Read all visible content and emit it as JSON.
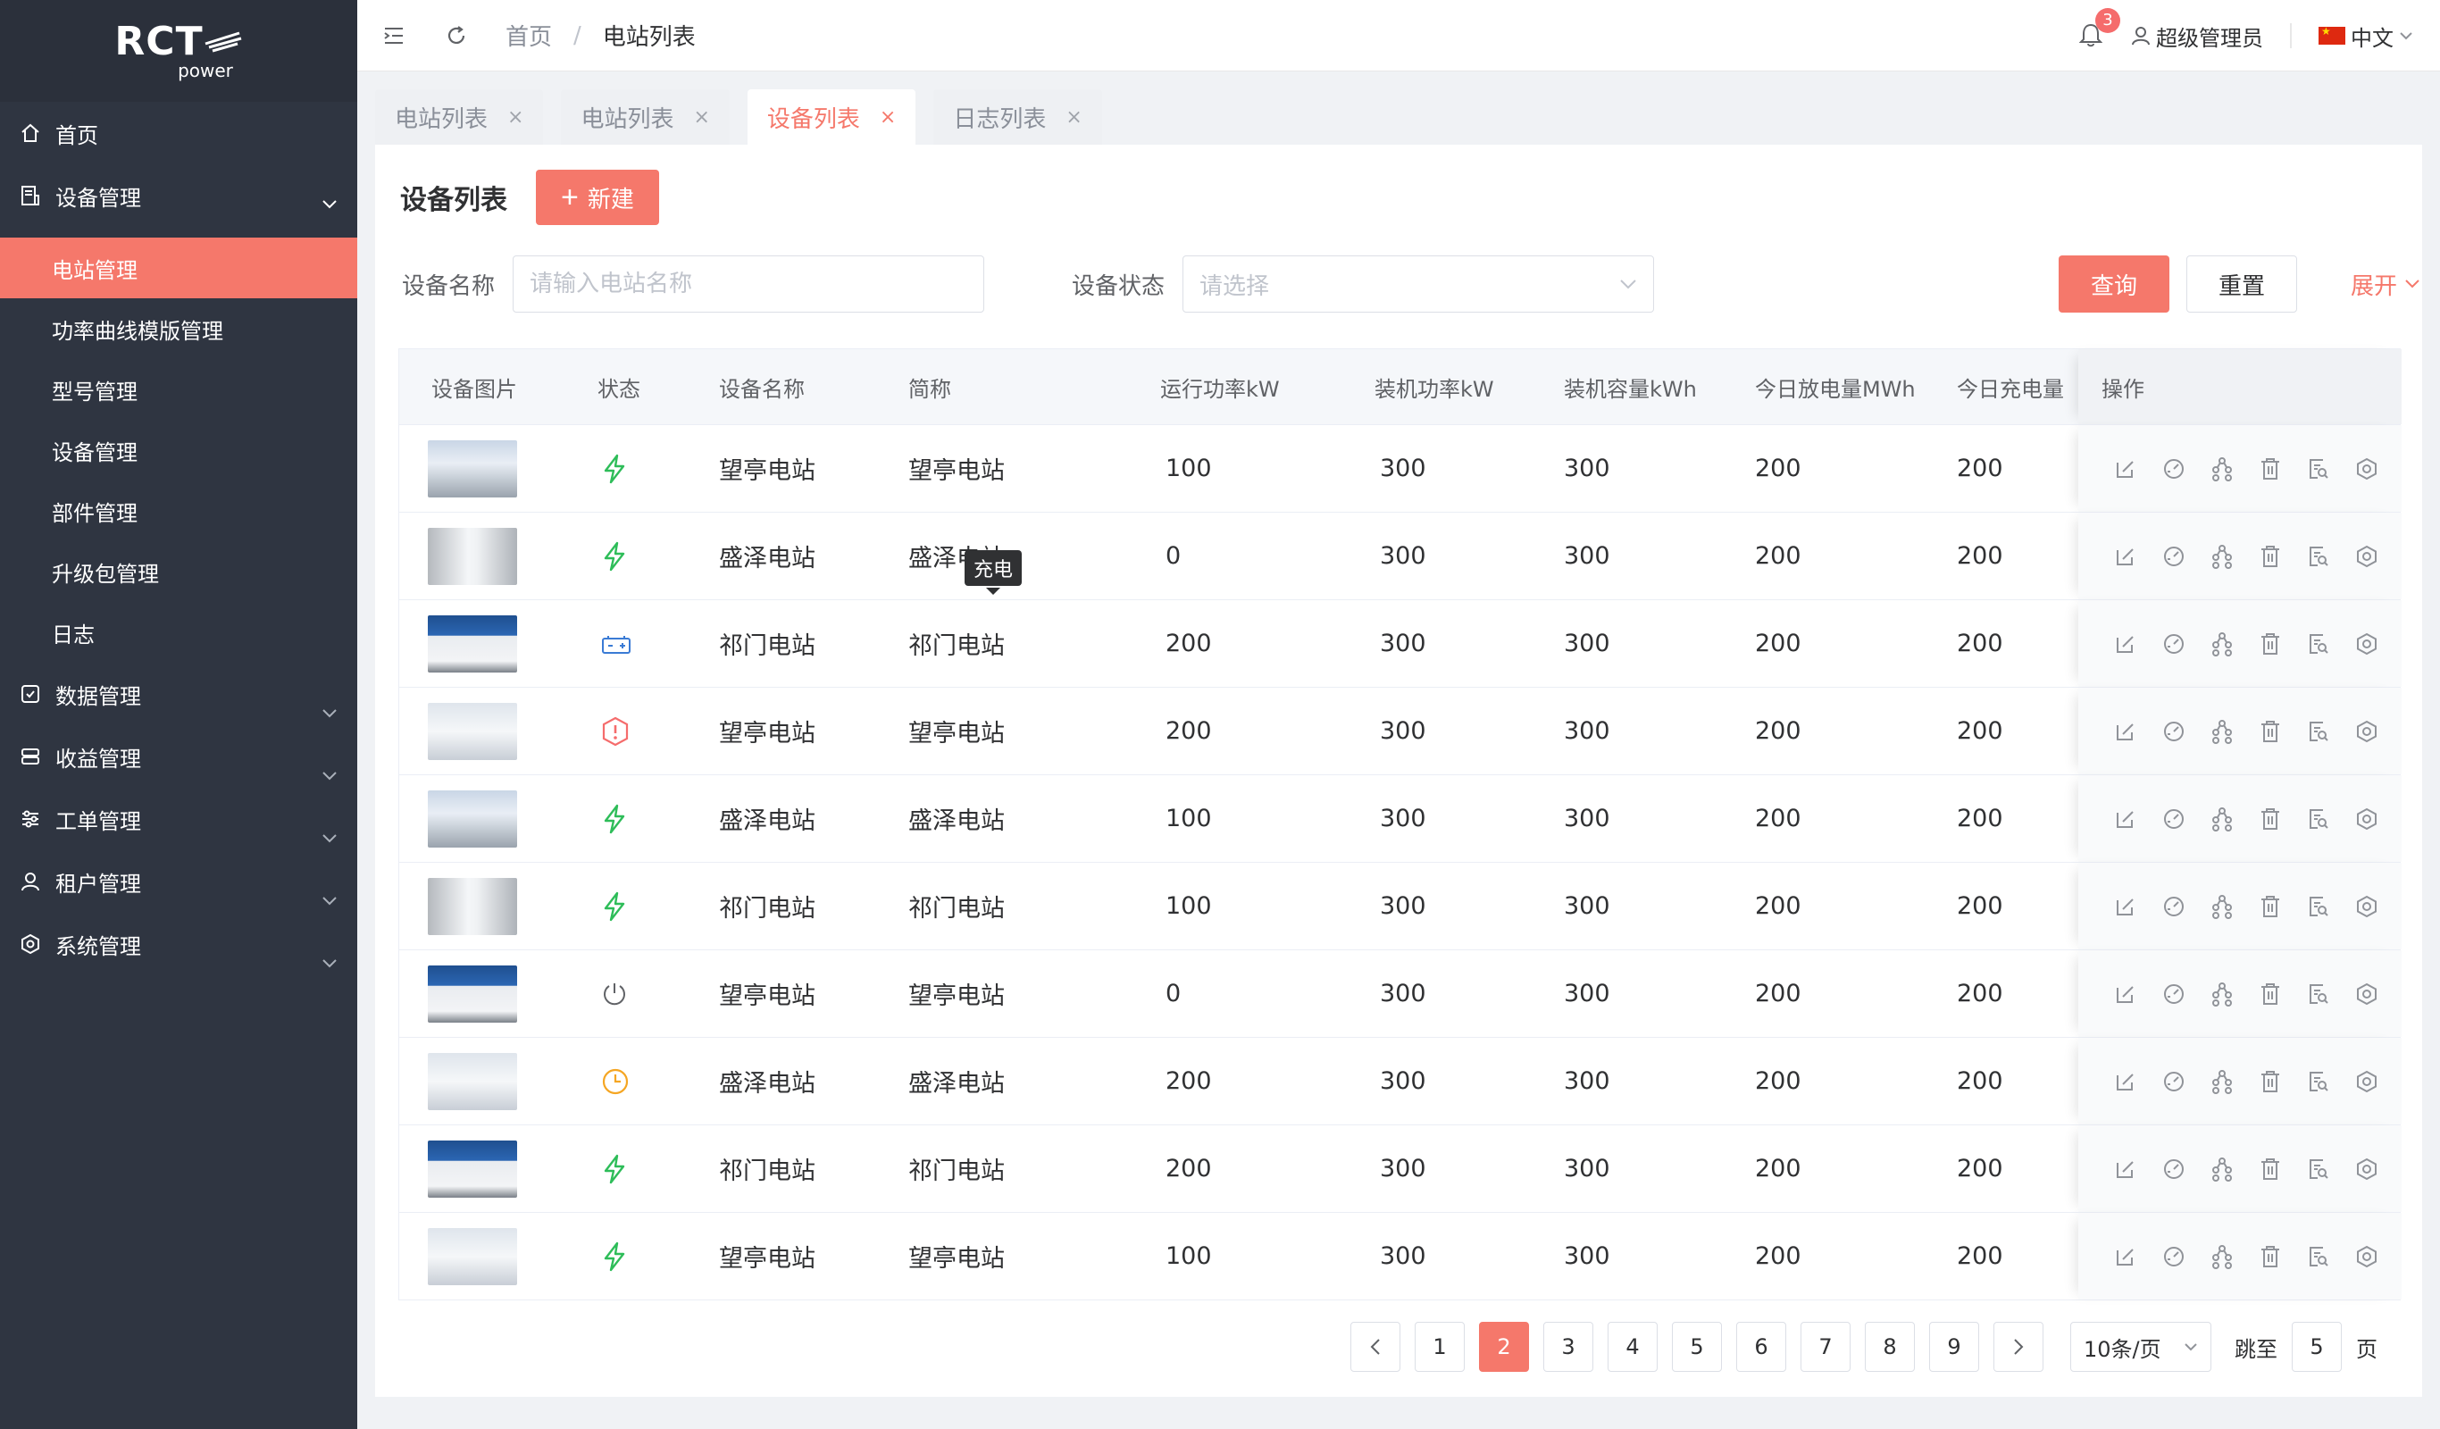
{
  "brand": {
    "name": "RCT",
    "sub": "power"
  },
  "sidebar": {
    "home": "首页",
    "device_mgmt": "设备管理",
    "subitems": [
      "电站管理",
      "功率曲线模版管理",
      "型号管理",
      "设备管理",
      "部件管理",
      "升级包管理",
      "日志"
    ],
    "groups": [
      "数据管理",
      "收益管理",
      "工单管理",
      "租户管理",
      "系统管理"
    ]
  },
  "header": {
    "crumbs": [
      "首页",
      "电站列表"
    ],
    "crumb_sep": "/",
    "notify_count": "3",
    "user": "超级管理员",
    "lang": "中文"
  },
  "tabs": [
    {
      "label": "电站列表"
    },
    {
      "label": "电站列表"
    },
    {
      "label": "设备列表"
    },
    {
      "label": "日志列表"
    }
  ],
  "tab_close": "×",
  "page": {
    "title": "设备列表",
    "new_button": "新建",
    "filters": {
      "name_label": "设备名称",
      "name_placeholder": "请输入电站名称",
      "status_label": "设备状态",
      "status_placeholder": "请选择"
    },
    "query_button": "查询",
    "reset_button": "重置",
    "expand": "展开"
  },
  "table": {
    "columns": [
      "设备图片",
      "状态",
      "设备名称",
      "简称",
      "运行功率kW",
      "装机功率kW",
      "装机容量kWh",
      "今日放电量MWh",
      "今日充电量",
      "操作"
    ],
    "tooltip": "充电",
    "rows": [
      {
        "img": "a",
        "status": "charging",
        "name": "望亭电站",
        "short": "望亭电站",
        "run": "100",
        "inst": "300",
        "cap": "300",
        "dis": "200",
        "chg": "200"
      },
      {
        "img": "b",
        "status": "charging",
        "name": "盛泽电站",
        "short": "盛泽电站",
        "run": "0",
        "inst": "300",
        "cap": "300",
        "dis": "200",
        "chg": "200"
      },
      {
        "img": "c",
        "status": "battery",
        "name": "祁门电站",
        "short": "祁门电站",
        "run": "200",
        "inst": "300",
        "cap": "300",
        "dis": "200",
        "chg": "200"
      },
      {
        "img": "d",
        "status": "alarm",
        "name": "望亭电站",
        "short": "望亭电站",
        "run": "200",
        "inst": "300",
        "cap": "300",
        "dis": "200",
        "chg": "200"
      },
      {
        "img": "a",
        "status": "charging",
        "name": "盛泽电站",
        "short": "盛泽电站",
        "run": "100",
        "inst": "300",
        "cap": "300",
        "dis": "200",
        "chg": "200"
      },
      {
        "img": "b",
        "status": "charging",
        "name": "祁门电站",
        "short": "祁门电站",
        "run": "100",
        "inst": "300",
        "cap": "300",
        "dis": "200",
        "chg": "200"
      },
      {
        "img": "c",
        "status": "offline",
        "name": "望亭电站",
        "short": "望亭电站",
        "run": "0",
        "inst": "300",
        "cap": "300",
        "dis": "200",
        "chg": "200"
      },
      {
        "img": "d",
        "status": "pending",
        "name": "盛泽电站",
        "short": "盛泽电站",
        "run": "200",
        "inst": "300",
        "cap": "300",
        "dis": "200",
        "chg": "200"
      },
      {
        "img": "c",
        "status": "charging",
        "name": "祁门电站",
        "short": "祁门电站",
        "run": "200",
        "inst": "300",
        "cap": "300",
        "dis": "200",
        "chg": "200"
      },
      {
        "img": "d",
        "status": "charging",
        "name": "望亭电站",
        "short": "望亭电站",
        "run": "100",
        "inst": "300",
        "cap": "300",
        "dis": "200",
        "chg": "200"
      }
    ],
    "op_icons": [
      "edit-icon",
      "gauge-icon",
      "topology-icon",
      "delete-icon",
      "detail-icon",
      "settings-icon"
    ]
  },
  "pagination": {
    "prev": "<",
    "next": ">",
    "pages": [
      "1",
      "2",
      "3",
      "4",
      "5",
      "6",
      "7",
      "8",
      "9"
    ],
    "current": "2",
    "page_size": "10条/页",
    "jump_label": "跳至",
    "jump_value": "5",
    "page_unit": "页"
  },
  "colors": {
    "accent": "#f5786b",
    "sidebar": "#2f3541",
    "charging": "#2ebd59",
    "battery": "#3a7bd5",
    "alarm": "#f56c6c",
    "pending": "#f5a623"
  }
}
